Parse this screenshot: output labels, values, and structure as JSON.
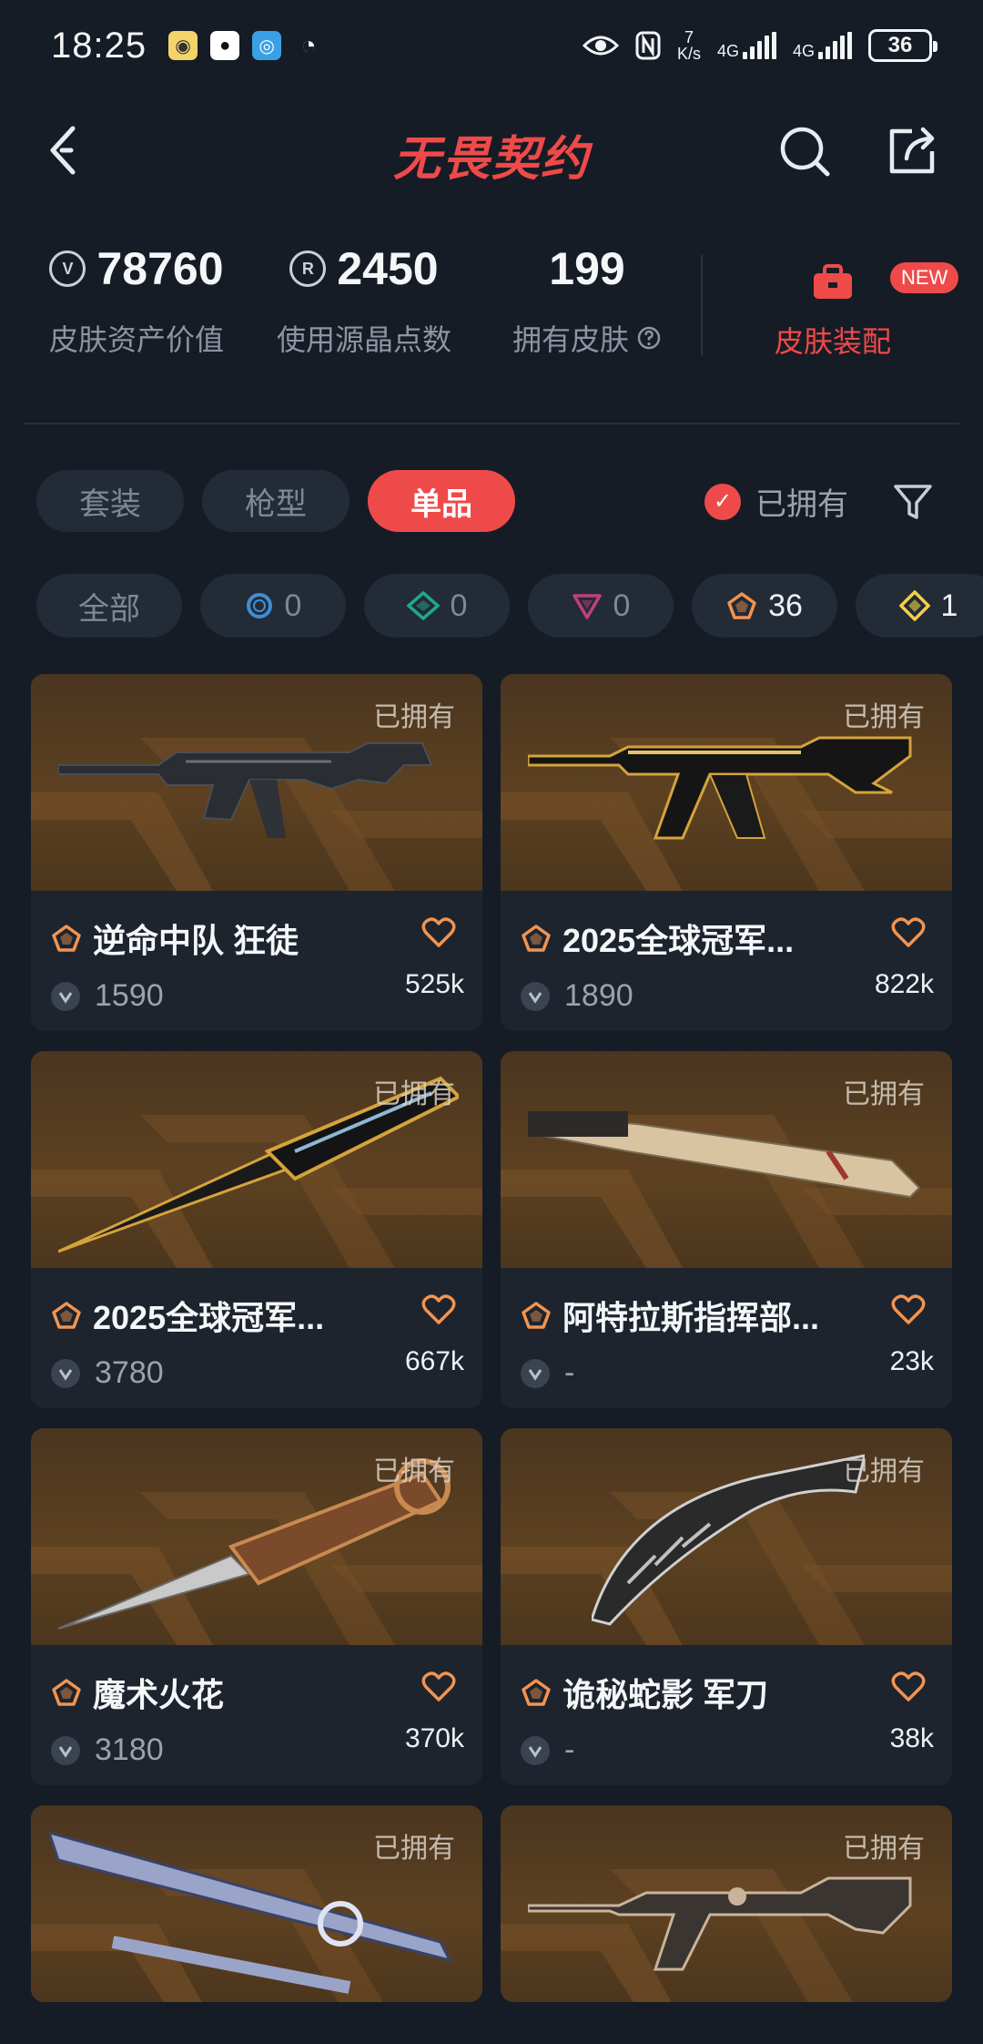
{
  "status": {
    "time": "18:25",
    "speed_value": "7",
    "speed_unit": "K/s",
    "net1": "4G",
    "net2": "4G",
    "battery": "36"
  },
  "header": {
    "title": "无畏契约"
  },
  "stats": {
    "asset_value": "78760",
    "asset_label": "皮肤资产价值",
    "radianite": "2450",
    "radianite_label": "使用源晶点数",
    "owned_count": "199",
    "owned_label": "拥有皮肤",
    "equip_badge": "NEW",
    "equip_label": "皮肤装配"
  },
  "tabs": [
    "套装",
    "枪型",
    "单品"
  ],
  "active_tab": "单品",
  "owned_filter": "已拥有",
  "rarity_chips": [
    {
      "label": "全部"
    },
    {
      "icon": "select-tier-icon",
      "count": "0",
      "color": "#3c8fd6"
    },
    {
      "icon": "deluxe-tier-icon",
      "count": "0",
      "color": "#1fa88b"
    },
    {
      "icon": "premium-tier-icon",
      "count": "0",
      "color": "#c0407a"
    },
    {
      "icon": "exclusive-tier-icon",
      "count": "36",
      "color": "#f29450"
    },
    {
      "icon": "ultra-tier-icon",
      "count": "1",
      "color": "#f2d04a"
    }
  ],
  "owned_tag": "已拥有",
  "cards": [
    {
      "name": "逆命中队 狂徒",
      "price": "1590",
      "likes": "525k"
    },
    {
      "name": "2025全球冠军...",
      "price": "1890",
      "likes": "822k"
    },
    {
      "name": "2025全球冠军...",
      "price": "3780",
      "likes": "667k"
    },
    {
      "name": "阿特拉斯指挥部...",
      "price": "-",
      "likes": "23k"
    },
    {
      "name": "魔术火花",
      "price": "3180",
      "likes": "370k"
    },
    {
      "name": "诡秘蛇影 军刀",
      "price": "-",
      "likes": "38k"
    }
  ],
  "colors": {
    "accent": "#ef4a4a",
    "background": "#161c25",
    "card": "#1d242e",
    "exclusive": "#f29450"
  }
}
